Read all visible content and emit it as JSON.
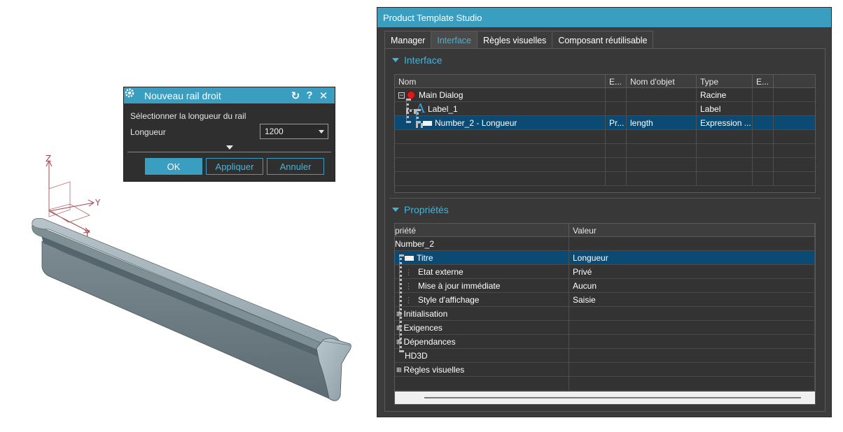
{
  "viewport": {
    "axes": {
      "z_label": "Z",
      "y_label": "Y",
      "x_label": "Y"
    }
  },
  "rail_dialog": {
    "title": "Nouveau rail droit",
    "prompt": "Sélectionner la longueur du rail",
    "length_label": "Longueur",
    "length_value": "1200",
    "buttons": {
      "ok": "OK",
      "apply": "Appliquer",
      "cancel": "Annuler"
    }
  },
  "studio": {
    "title": "Product Template Studio",
    "tabs": [
      {
        "label": "Manager",
        "active": false
      },
      {
        "label": "Interface",
        "active": true
      },
      {
        "label": "Règles visuelles",
        "active": false
      },
      {
        "label": "Composant réutilisable",
        "active": false
      }
    ],
    "interface_section": {
      "title": "Interface",
      "columns": [
        "Nom",
        "E...",
        "Nom d'objet",
        "Type",
        "E..."
      ],
      "rows": [
        {
          "name": "Main Dialog",
          "e1": "",
          "object_name": "",
          "type": "Racine",
          "e2": "",
          "icon": "red-circle-icon"
        },
        {
          "name": "Label_1",
          "e1": "",
          "object_name": "",
          "type": "Label",
          "e2": "",
          "icon": "label-a-icon"
        },
        {
          "name": "Number_2 - Longueur",
          "e1": "Pr...",
          "object_name": "length",
          "type": "Expression ...",
          "e2": "",
          "icon": "number-field-icon",
          "selected": true
        }
      ]
    },
    "properties_section": {
      "title": "Propriétés",
      "columns": [
        "priété",
        "Valeur"
      ],
      "group": "Number_2",
      "rows": [
        {
          "name": "Titre",
          "value": "Longueur",
          "selected": true,
          "icon": "abc-field-icon"
        },
        {
          "name": "Etat externe",
          "value": "Privé",
          "icon": "list-icon"
        },
        {
          "name": "Mise à jour immédiate",
          "value": "Aucun",
          "icon": "list-icon"
        },
        {
          "name": "Style d'affichage",
          "value": "Saisie",
          "icon": "list-icon"
        }
      ],
      "groups": [
        "Initialisation",
        "Exigences",
        "Dépendances",
        "HD3D",
        "Règles visuelles"
      ]
    },
    "colors": {
      "accent": "#3a9ec1",
      "selection": "#0b4a72",
      "panel": "#3c3c3c",
      "red_node": "#d91b1b"
    }
  }
}
